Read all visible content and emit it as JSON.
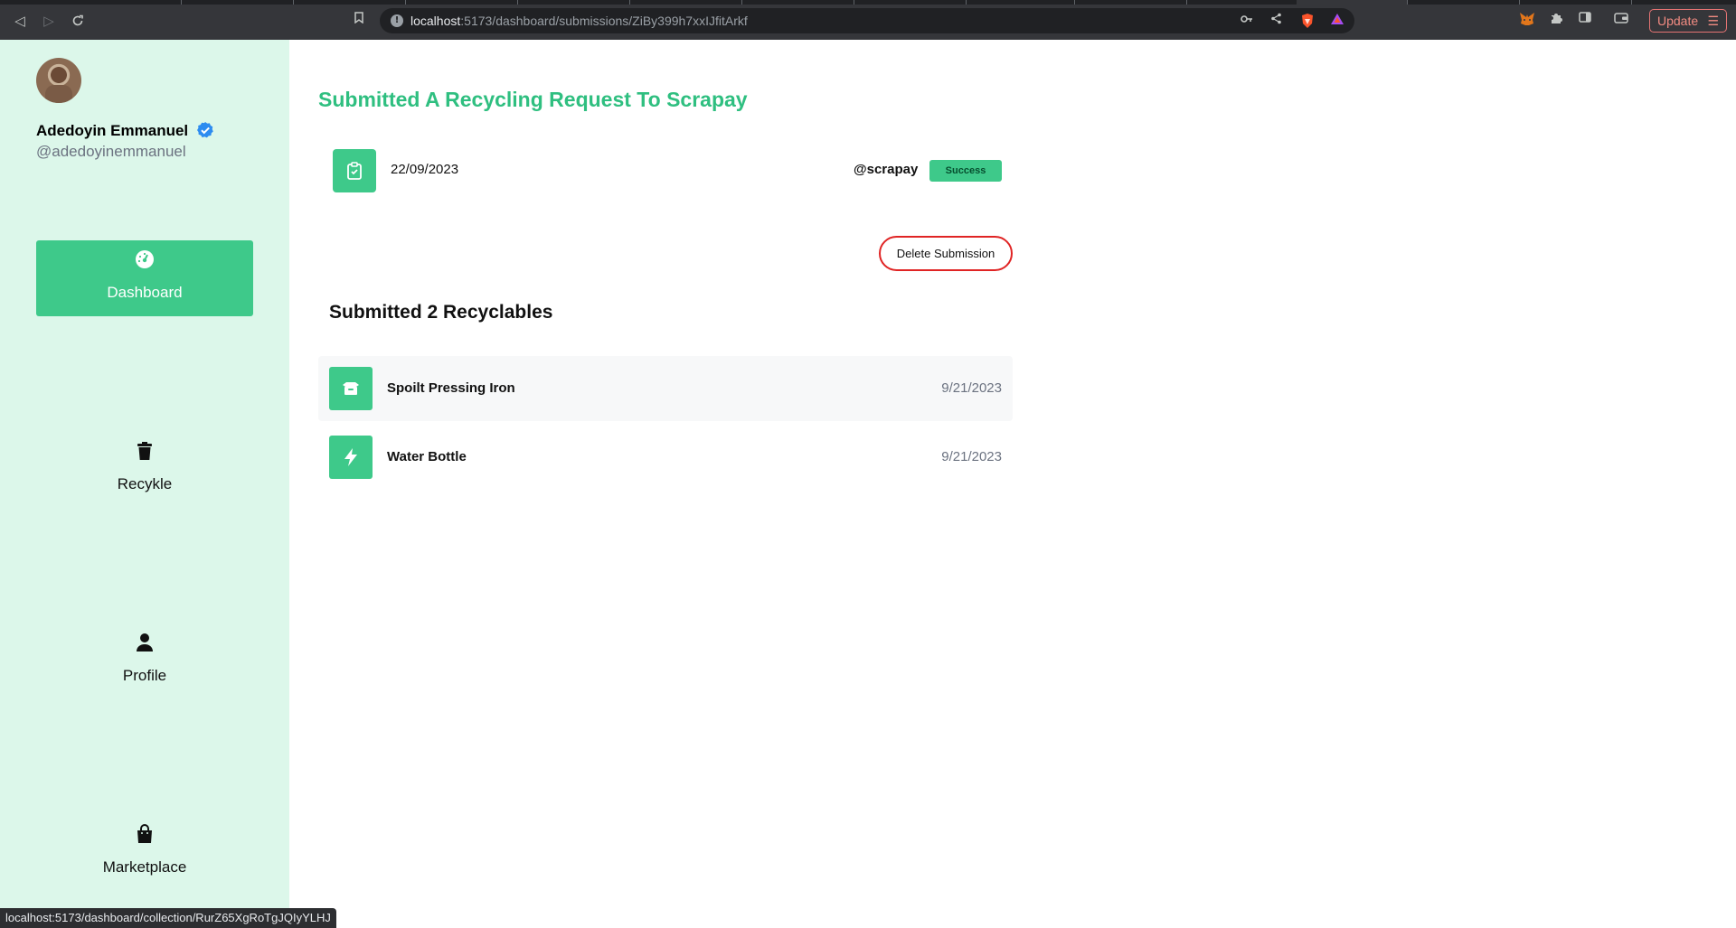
{
  "browser": {
    "url_host": "localhost",
    "url_path": ":5173/dashboard/submissions/ZiBy399h7xxIJfitArkf",
    "update_label": "Update",
    "status_url": "localhost:5173/dashboard/collection/RurZ65XgRoTgJQIyYLHJ"
  },
  "profile": {
    "name": "Adedoyin Emmanuel",
    "handle": "@adedoyinemmanuel"
  },
  "sidebar": {
    "items": [
      {
        "label": "Dashboard",
        "icon": "gauge-icon",
        "active": true
      },
      {
        "label": "Recykle",
        "icon": "trash-icon",
        "active": false
      },
      {
        "label": "Profile",
        "icon": "person-icon",
        "active": false
      },
      {
        "label": "Marketplace",
        "icon": "shopping-bag-icon",
        "active": false
      }
    ]
  },
  "submission": {
    "title": "Submitted A Recycling Request To Scrapay",
    "date": "22/09/2023",
    "handle": "@scrapay",
    "status": "Success",
    "delete_label": "Delete Submission",
    "section_title": "Submitted 2 Recyclables",
    "items": [
      {
        "name": "Spoilt Pressing Iron",
        "date": "9/21/2023",
        "icon": "open-box-icon"
      },
      {
        "name": "Water Bottle",
        "date": "9/21/2023",
        "icon": "lightning-icon"
      }
    ]
  },
  "colors": {
    "accent": "#3ec98a",
    "title_green": "#2fbf80",
    "sidebar_bg": "#dcf7ea",
    "danger": "#e02424"
  }
}
